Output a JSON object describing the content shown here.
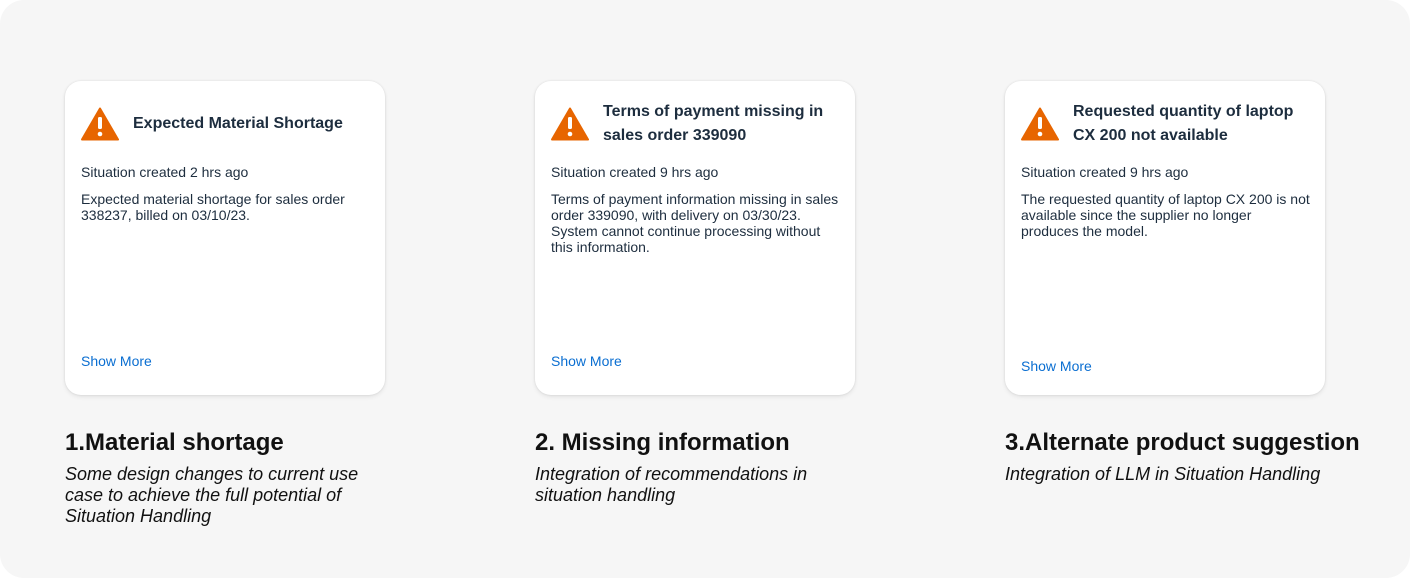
{
  "colors": {
    "background": "#f6f6f6",
    "card": "#ffffff",
    "warning_icon": "#e76500",
    "link": "#0a6ed1",
    "text": "#1d2d3e"
  },
  "cards": [
    {
      "icon": "warning-icon",
      "title": "Expected Material Shortage",
      "meta": "Situation created 2 hrs ago",
      "description": "Expected material shortage for sales order 338237, billed on 03/10/23.",
      "link": "Show More",
      "caption_title": "1.Material shortage",
      "caption_sub": "Some design changes to current use case to achieve the full potential of Situation Handling"
    },
    {
      "icon": "warning-icon",
      "title": "Terms of payment missing in sales order 339090",
      "meta": "Situation created 9 hrs ago",
      "description": "Terms of payment information missing in sales order 339090, with delivery on 03/30/23. System cannot continue processing without this information.",
      "link": "Show More",
      "caption_title": "2. Missing information",
      "caption_sub": "Integration of recommendations in situation handling"
    },
    {
      "icon": "warning-icon",
      "title": "Requested quantity of laptop CX 200 not available",
      "meta": "Situation created 9 hrs ago",
      "description": "The requested quantity of laptop CX 200 is not available since the supplier no longer produces the model.",
      "link": "Show More",
      "caption_title": "3.Alternate product suggestion",
      "caption_sub": "Integration of LLM in Situation Handling"
    }
  ]
}
